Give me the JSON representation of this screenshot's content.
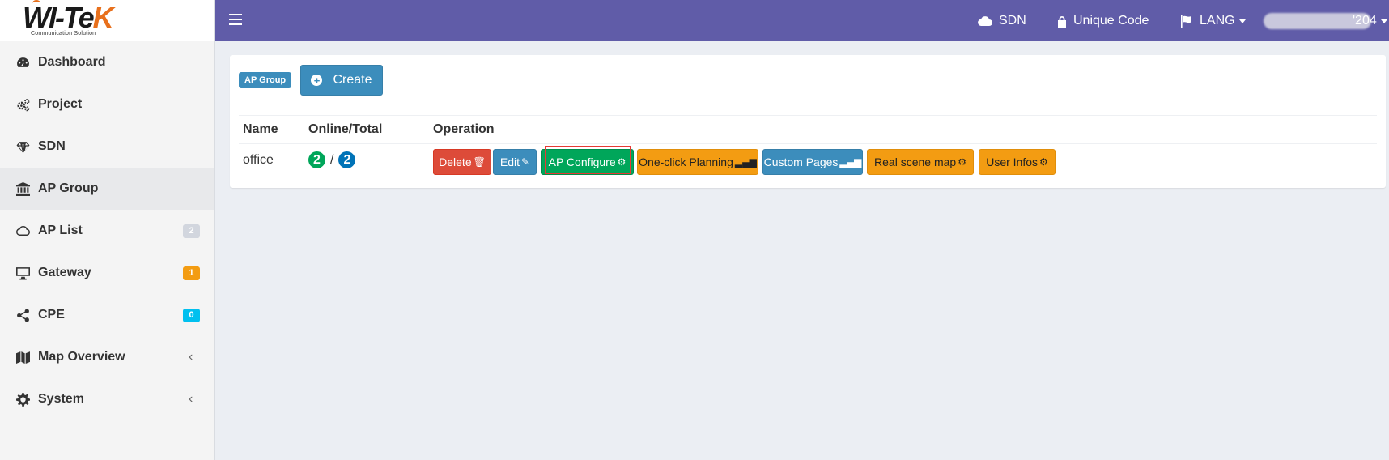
{
  "logo": {
    "text_main": "WI-Te",
    "text_accent": "K",
    "tagline": "Communication Solution"
  },
  "sidebar": {
    "items": [
      {
        "label": "Dashboard",
        "icon": "dashboard-icon"
      },
      {
        "label": "Project",
        "icon": "gears-icon"
      },
      {
        "label": "SDN",
        "icon": "diamond-icon"
      },
      {
        "label": "AP Group",
        "icon": "bank-icon",
        "active": true
      },
      {
        "label": "AP List",
        "icon": "cloud-icon",
        "badge": "2",
        "badge_color": "#d2d6de"
      },
      {
        "label": "Gateway",
        "icon": "desktop-icon",
        "badge": "1",
        "badge_color": "#f39c12"
      },
      {
        "label": "CPE",
        "icon": "share-icon",
        "badge": "0",
        "badge_color": "#00c0ef"
      },
      {
        "label": "Map Overview",
        "icon": "map-icon",
        "chevron": "‹"
      },
      {
        "label": "System",
        "icon": "gear-icon",
        "chevron": "‹"
      }
    ]
  },
  "topbar": {
    "sdn_label": "SDN",
    "unique_code_label": "Unique Code",
    "lang_label": "LANG",
    "user_suffix": "'204"
  },
  "content": {
    "group_label": "AP Group",
    "create_label": "Create",
    "table": {
      "headers": [
        "Name",
        "Online/Total",
        "Operation"
      ],
      "rows": [
        {
          "name": "office",
          "online": "2",
          "total": "2",
          "online_color": "#00a65a",
          "total_color": "#0073b7"
        }
      ]
    },
    "operations": [
      {
        "label": "Delete",
        "icon": "trash-icon",
        "color": "#dd4b39"
      },
      {
        "label": "Edit",
        "icon": "pencil-icon",
        "color": "#3c8dbc"
      },
      {
        "label": "AP Configure",
        "icon": "gear-icon",
        "color": "#00a65a",
        "highlighted": true
      },
      {
        "label": "One-click Planning",
        "icon": "signal-icon",
        "color": "#f39c12"
      },
      {
        "label": "Custom Pages",
        "icon": "signal-icon",
        "color": "#3c8dbc"
      },
      {
        "label": "Real scene map",
        "icon": "gear-icon",
        "color": "#f39c12"
      },
      {
        "label": "User Infos",
        "icon": "gear-icon",
        "color": "#f39c12"
      }
    ]
  }
}
